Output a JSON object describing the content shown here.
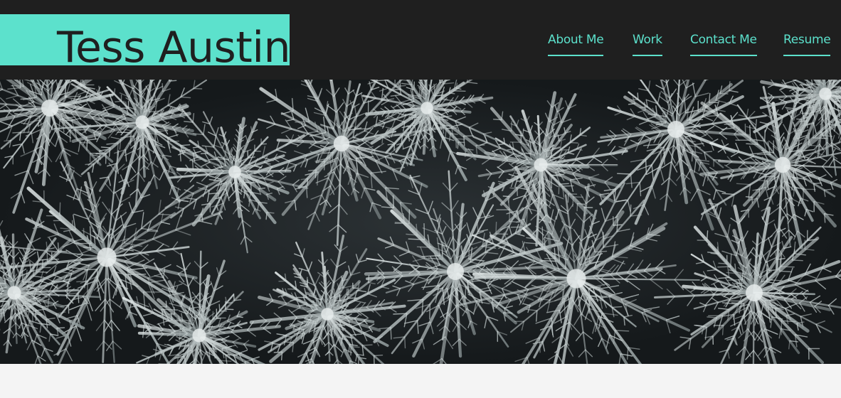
{
  "header": {
    "brand_name": "Tess Austin",
    "nav": [
      {
        "label": "About Me"
      },
      {
        "label": "Work"
      },
      {
        "label": "Contact Me"
      },
      {
        "label": "Resume"
      }
    ]
  },
  "hero": {
    "image_subject": "snow-covered-pine-trees-aerial"
  },
  "colors": {
    "accent": "#5ce1cc",
    "header_bg": "#1f1f1f",
    "page_bg": "#f4f4f4",
    "hero_bg": "#1b1f21"
  }
}
